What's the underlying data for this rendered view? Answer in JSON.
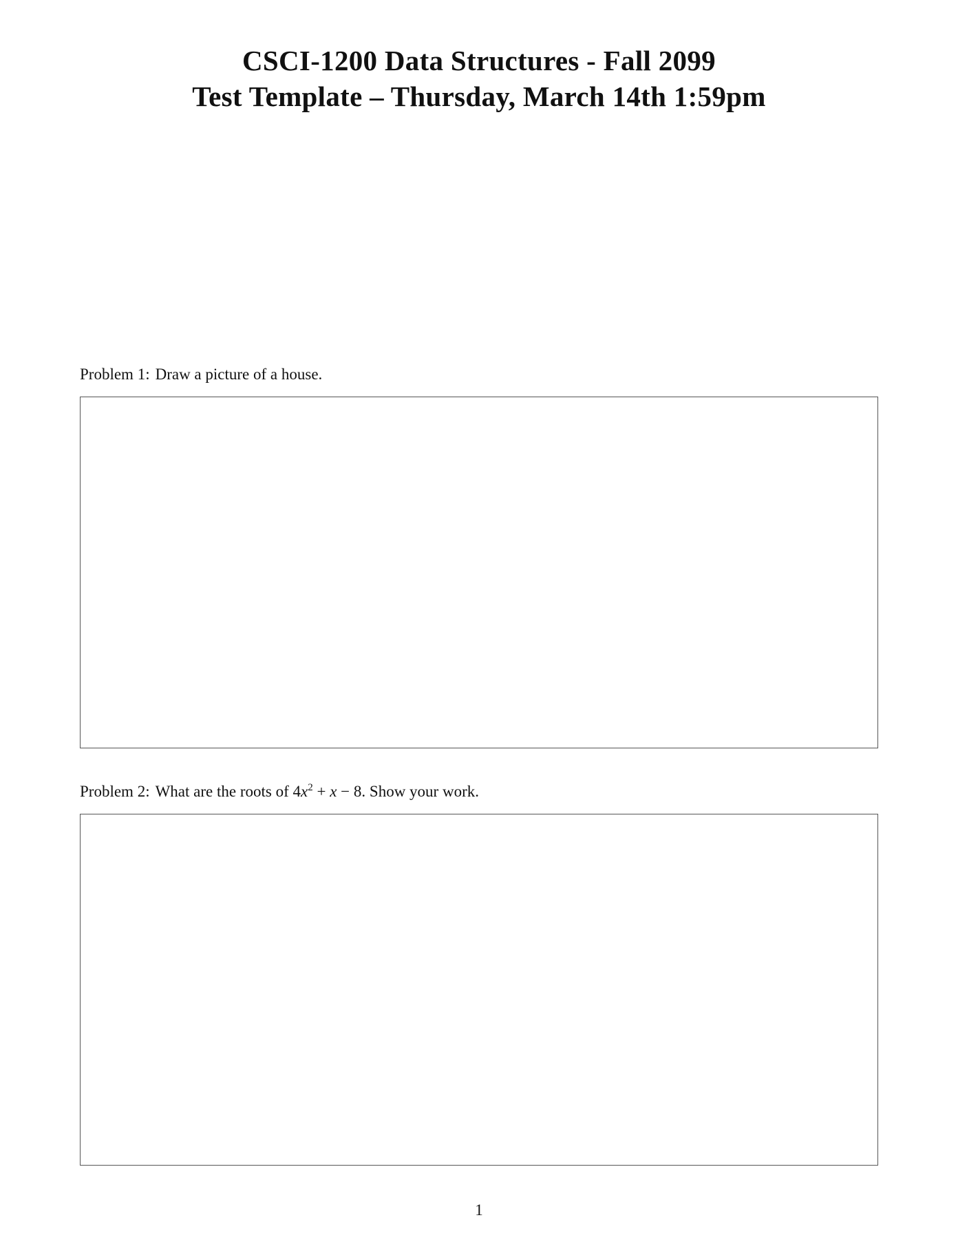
{
  "header": {
    "line1": "CSCI-1200 Data Structures - Fall 2099",
    "line2": "Test Template – Thursday, March 14th 1:59pm"
  },
  "problems": [
    {
      "label": "Problem 1:",
      "text": "Draw a picture of a house."
    },
    {
      "label": "Problem 2:",
      "text_before": "What are the roots of",
      "math": {
        "coef": "4",
        "var": "x",
        "exp": "2",
        "rest_op1": "+",
        "rest_var": "x",
        "rest_op2": "−",
        "rest_const": "8"
      },
      "text_after": ". Show your work."
    }
  ],
  "footer": {
    "page_number": "1"
  }
}
